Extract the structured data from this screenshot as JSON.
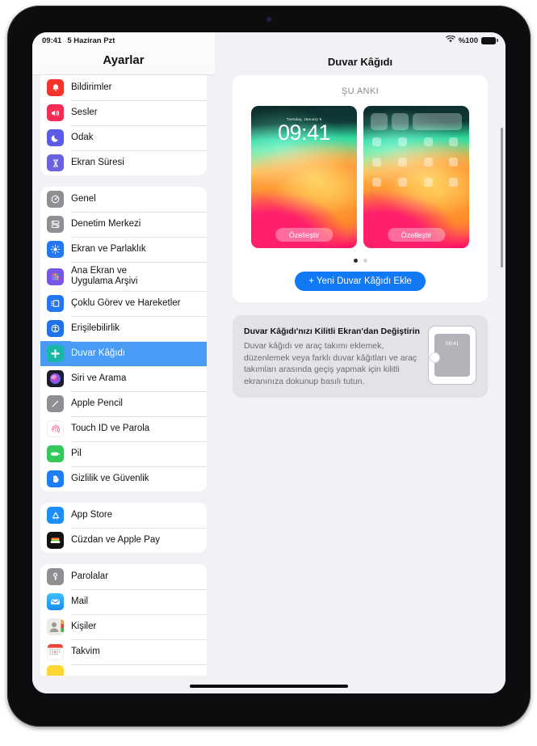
{
  "status_bar": {
    "time": "09:41",
    "date": "5 Haziran Pzt",
    "battery_percent": "%100",
    "wifi_icon": "wifi-icon",
    "battery_icon": "battery-icon"
  },
  "sidebar": {
    "title": "Ayarlar",
    "groups": [
      {
        "items": [
          {
            "label": "Bildirimler",
            "icon": "bell-icon",
            "color": "#f7342c"
          },
          {
            "label": "Sesler",
            "icon": "speaker-icon",
            "color": "#f62b56"
          },
          {
            "label": "Odak",
            "icon": "moon-icon",
            "color": "#5a5ce6"
          },
          {
            "label": "Ekran Süresi",
            "icon": "hourglass-icon",
            "color": "#6b62e0"
          }
        ]
      },
      {
        "items": [
          {
            "label": "Genel",
            "icon": "gear-icon",
            "color": "#8e8e93"
          },
          {
            "label": "Denetim Merkezi",
            "icon": "sliders-icon",
            "color": "#8e8e93"
          },
          {
            "label": "Ekran ve Parlaklık",
            "icon": "brightness-icon",
            "color": "#2477f2"
          },
          {
            "label": "Ana Ekran ve\nUygulama Arşivi",
            "icon": "app-grid-icon",
            "color": "#7b55e8"
          },
          {
            "label": "Çoklu Görev ve Hareketler",
            "icon": "multitask-icon",
            "color": "#2477f2"
          },
          {
            "label": "Erişilebilirlik",
            "icon": "accessibility-icon",
            "color": "#1f72e8"
          },
          {
            "label": "Duvar Kâğıdı",
            "icon": "wallpaper-icon",
            "color": "#19b7a8",
            "selected": true
          },
          {
            "label": "Siri ve Arama",
            "icon": "siri-icon",
            "color": "#1c1c2b"
          },
          {
            "label": "Apple Pencil",
            "icon": "pencil-icon",
            "color": "#8e8e93"
          },
          {
            "label": "Touch ID ve Parola",
            "icon": "fingerprint-icon",
            "color": "#ffffff"
          },
          {
            "label": "Pil",
            "icon": "battery-green-icon",
            "color": "#34c759"
          },
          {
            "label": "Gizlilik ve Güvenlik",
            "icon": "hand-icon",
            "color": "#1c7df4"
          }
        ]
      },
      {
        "items": [
          {
            "label": "App Store",
            "icon": "appstore-icon",
            "color": "#1c8ef5"
          },
          {
            "label": "Cüzdan ve Apple Pay",
            "icon": "wallet-icon",
            "color": "#121212"
          }
        ]
      },
      {
        "items": [
          {
            "label": "Parolalar",
            "icon": "key-icon",
            "color": "#8e8e93"
          },
          {
            "label": "Mail",
            "icon": "mail-icon",
            "color": "#22a6f7"
          },
          {
            "label": "Kişiler",
            "icon": "contacts-icon",
            "color": "#e8e6e1"
          },
          {
            "label": "Takvim",
            "icon": "calendar-icon",
            "color": "#ffffff"
          },
          {
            "label": "",
            "icon": "notes-icon",
            "color": "#fdd835"
          }
        ]
      }
    ]
  },
  "main": {
    "title": "Duvar Kâğıdı",
    "section_label": "ŞU ANKI",
    "previews": [
      {
        "type": "lock-screen",
        "date": "Tuesday, January 9",
        "time": "09:41",
        "customize_label": "Özelleştir"
      },
      {
        "type": "home-screen",
        "customize_label": "Özelleştir"
      }
    ],
    "pager": {
      "total": 2,
      "active_index": 0
    },
    "add_wallpaper_label": "+ Yeni Duvar Kâğıdı Ekle",
    "info_card": {
      "title": "Duvar Kâğıdı'nızı Kilitli Ekran'dan Değiştirin",
      "body": "Duvar kâğıdı ve araç takımı eklemek, düzenlemek veya farklı duvar kâğıtları ve araç takımları arasında geçiş yapmak için kilitli ekranınıza dokunup basılı tutun.",
      "illustration_time": "09:41"
    }
  },
  "colors": {
    "accent": "#1279f4",
    "selected_row": "#4a9bf5",
    "background": "#f2f1f6"
  }
}
